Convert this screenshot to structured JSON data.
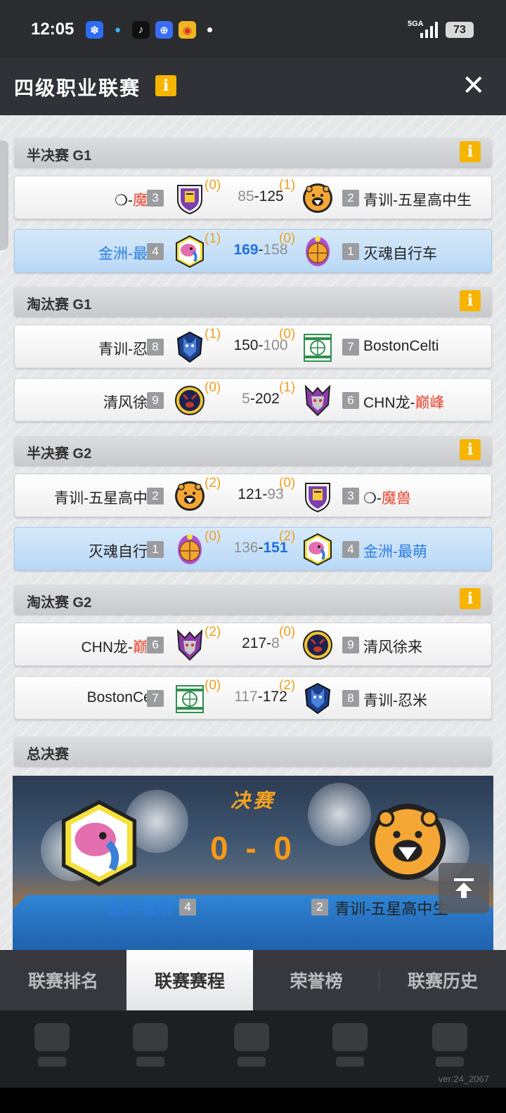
{
  "status_bar": {
    "time": "12:05",
    "network": "5GA",
    "battery": "73",
    "app_icons": [
      "baidu-icon",
      "qq-icon",
      "tiktok-icon",
      "tieba-icon",
      "weibo-icon"
    ]
  },
  "header": {
    "title": "四级职业联赛",
    "info_label": "i",
    "close_label": "✕"
  },
  "sections": [
    {
      "title": "半决赛 G1",
      "info": "i",
      "matches": [
        {
          "left_name_prefix": "❍-",
          "left_name_main": "魔兽",
          "left_style": "red-suffix",
          "left_seed": "3",
          "left_wins": "(0)",
          "left_score": "85",
          "right_score": "125",
          "right_wins": "(1)",
          "right_seed": "2",
          "right_name_prefix": "",
          "right_name_main": "青训-五星高中生",
          "winner": "right",
          "highlight": false,
          "left_logo": "knight-logo",
          "right_logo": "bear-logo"
        },
        {
          "left_name_prefix": "金洲-最萌",
          "left_name_main": "",
          "left_style": "blue",
          "left_seed": "4",
          "left_wins": "(1)",
          "left_score": "169",
          "right_score": "158",
          "right_wins": "(0)",
          "right_seed": "1",
          "right_name_prefix": "",
          "right_name_main": "灭魂自行车",
          "winner": "left",
          "highlight": true,
          "left_logo": "elephant-logo",
          "right_logo": "ball-logo"
        }
      ]
    },
    {
      "title": "淘汰赛 G1",
      "info": "i",
      "matches": [
        {
          "left_name_prefix": "",
          "left_name_main": "青训-忍米",
          "left_style": "plain",
          "left_seed": "8",
          "left_wins": "(1)",
          "left_score": "150",
          "right_score": "100",
          "right_wins": "(0)",
          "right_seed": "7",
          "right_name_prefix": "",
          "right_name_main": "BostonCelti",
          "winner": "left",
          "highlight": false,
          "left_logo": "wolf-logo",
          "right_logo": "celtic-logo"
        },
        {
          "left_name_prefix": "",
          "left_name_main": "清风徐来",
          "left_style": "plain",
          "left_seed": "9",
          "left_wins": "(0)",
          "left_score": "5",
          "right_score": "202",
          "right_wins": "(1)",
          "right_seed": "6",
          "right_name_prefix": "CHN龙-",
          "right_name_main": "巅峰",
          "winner": "right",
          "highlight": false,
          "left_logo": "boar-logo",
          "right_logo": "dragon-logo"
        }
      ]
    },
    {
      "title": "半决赛 G2",
      "info": "i",
      "matches": [
        {
          "left_name_prefix": "",
          "left_name_main": "青训-五星高中生",
          "left_style": "plain",
          "left_seed": "2",
          "left_wins": "(2)",
          "left_score": "121",
          "right_score": "93",
          "right_wins": "(0)",
          "right_seed": "3",
          "right_name_prefix": "❍-",
          "right_name_main": "魔兽",
          "winner": "left",
          "highlight": false,
          "left_logo": "bear-logo",
          "right_logo": "knight-logo"
        },
        {
          "left_name_prefix": "",
          "left_name_main": "灭魂自行车",
          "left_style": "plain",
          "left_seed": "1",
          "left_wins": "(0)",
          "left_score": "136",
          "right_score": "151",
          "right_wins": "(2)",
          "right_seed": "4",
          "right_name_prefix": "金洲-最萌",
          "right_name_main": "",
          "winner": "right",
          "highlight": true,
          "left_logo": "ball-logo",
          "right_logo": "elephant-logo"
        }
      ]
    },
    {
      "title": "淘汰赛 G2",
      "info": "i",
      "matches": [
        {
          "left_name_prefix": "CHN龙-",
          "left_name_main": "巅峰",
          "left_style": "red-suffix",
          "left_seed": "6",
          "left_wins": "(2)",
          "left_score": "217",
          "right_score": "8",
          "right_wins": "(0)",
          "right_seed": "9",
          "right_name_prefix": "",
          "right_name_main": "清风徐来",
          "winner": "left",
          "highlight": false,
          "left_logo": "dragon-logo",
          "right_logo": "boar-logo"
        },
        {
          "left_name_prefix": "",
          "left_name_main": "BostonCelti",
          "left_style": "plain",
          "left_seed": "7",
          "left_wins": "(0)",
          "left_score": "117",
          "right_score": "172",
          "right_wins": "(2)",
          "right_seed": "8",
          "right_name_prefix": "",
          "right_name_main": "青训-忍米",
          "winner": "right",
          "highlight": false,
          "left_logo": "celtic-logo",
          "right_logo": "wolf-logo"
        }
      ]
    }
  ],
  "final": {
    "section_title": "总决赛",
    "title": "决赛",
    "score": "0 - 0",
    "left_team": "金洲-最萌",
    "left_seed": "4",
    "left_logo": "elephant-logo",
    "right_team": "青训-五星高中生",
    "right_seed": "2",
    "right_logo": "bear-logo"
  },
  "tabs": [
    {
      "label": "联赛排名",
      "active": false
    },
    {
      "label": "联赛赛程",
      "active": true
    },
    {
      "label": "荣誉榜",
      "active": false
    },
    {
      "label": "联赛历史",
      "active": false
    }
  ],
  "version": "ver:24_2067",
  "colors": {
    "accent_orange": "#f6b400",
    "win_blue": "#1d6fe0",
    "name_red": "#e8432f",
    "highlight_row": "#c7e1f8"
  }
}
